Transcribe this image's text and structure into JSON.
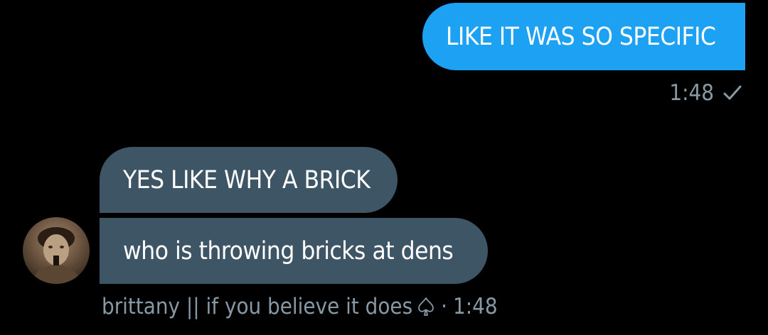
{
  "messages": {
    "outgoing": {
      "text": "LIKE IT WAS SO SPECIFIC",
      "time": "1:48",
      "status_icon": "check-icon"
    },
    "incoming": [
      {
        "text": "YES LIKE WHY A BRICK"
      },
      {
        "text": "who is throwing bricks at dens"
      }
    ],
    "incoming_meta": {
      "sender_name": "brittany || if you believe it does",
      "sender_icon": "spade-icon",
      "separator": "·",
      "time": "1:48"
    }
  },
  "colors": {
    "background": "#000000",
    "outgoing_bubble": "#1DA1F2",
    "incoming_bubble": "#3E5566",
    "meta_text": "#8899A6"
  }
}
